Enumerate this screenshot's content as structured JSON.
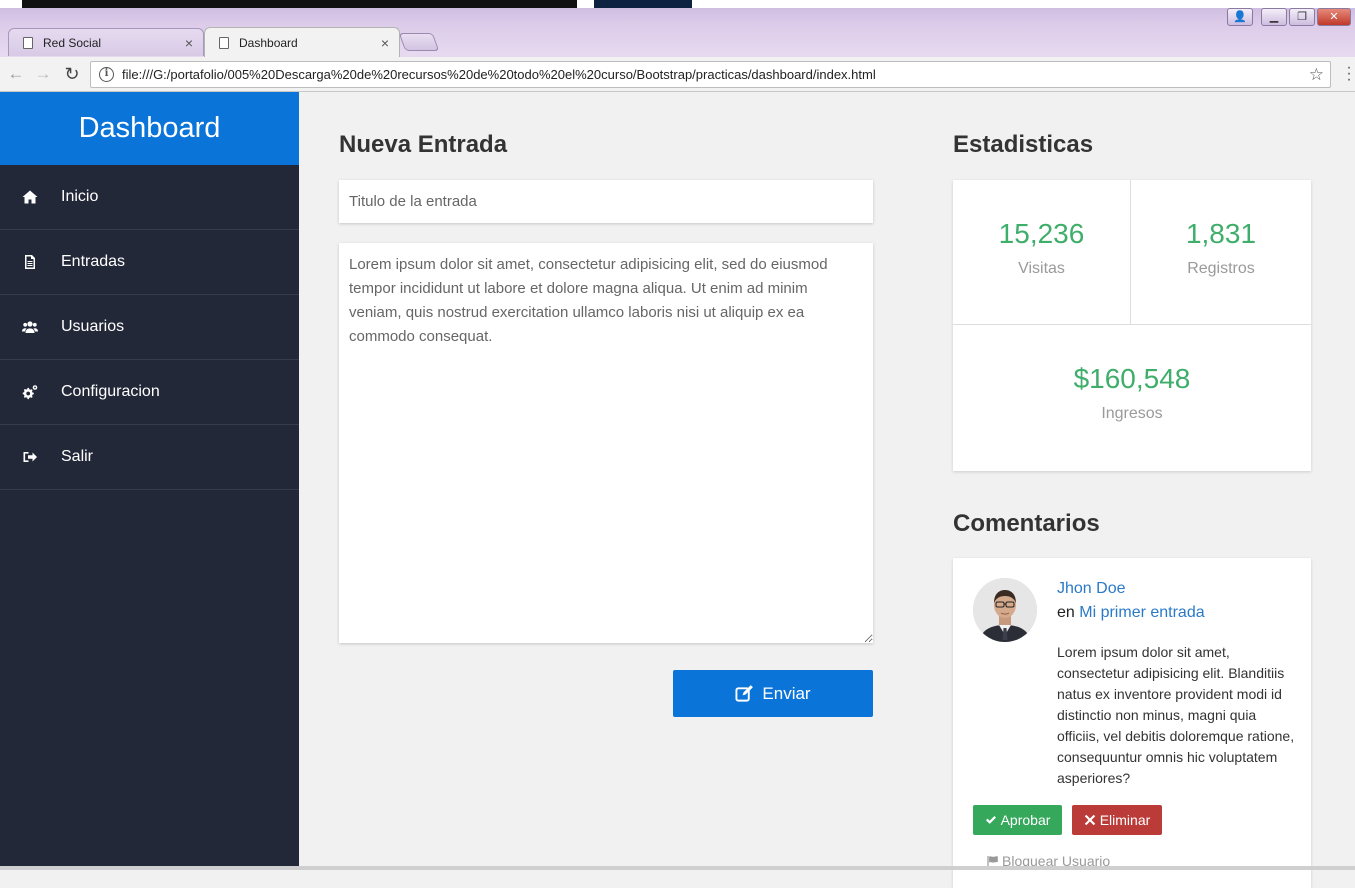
{
  "browser": {
    "tabs": [
      {
        "label": "Red Social",
        "close": "×"
      },
      {
        "label": "Dashboard",
        "close": "×"
      }
    ],
    "url": "file:///G:/portafolio/005%20Descarga%20de%20recursos%20de%20todo%20el%20curso/Bootstrap/practicas/dashboard/index.html",
    "info_icon": "i",
    "back_icon": "←",
    "forward_icon": "→",
    "reload_icon": "↻",
    "star_icon": "☆",
    "window_buttons": {
      "minimize": "▁",
      "restore": "❐",
      "close": "✕",
      "user": "👤"
    }
  },
  "sidebar": {
    "brand": "Dashboard",
    "items": [
      {
        "label": "Inicio",
        "icon": "home-icon"
      },
      {
        "label": "Entradas",
        "icon": "file-icon"
      },
      {
        "label": "Usuarios",
        "icon": "users-icon"
      },
      {
        "label": "Configuracion",
        "icon": "cogs-icon"
      },
      {
        "label": "Salir",
        "icon": "sign-out-icon"
      }
    ]
  },
  "new_post": {
    "title": "Nueva Entrada",
    "title_placeholder": "Titulo de la entrada",
    "body": "Lorem ipsum dolor sit amet, consectetur adipisicing elit, sed do eiusmod tempor incididunt ut labore et dolore magna aliqua. Ut enim ad minim veniam, quis nostrud exercitation ullamco laboris nisi ut aliquip ex ea commodo consequat.",
    "submit_label": "Enviar"
  },
  "stats": {
    "title": "Estadisticas",
    "visits": {
      "value": "15,236",
      "label": "Visitas"
    },
    "registers": {
      "value": "1,831",
      "label": "Registros"
    },
    "income": {
      "value": "$160,548",
      "label": "Ingresos"
    }
  },
  "comments": {
    "title": "Comentarios",
    "items": [
      {
        "author": "Jhon Doe",
        "prefix": "en",
        "post": "Mi primer entrada",
        "text": "Lorem ipsum dolor sit amet, consectetur adipisicing elit. Blanditiis natus ex inventore provident modi id distinctio non minus, magni quia officiis, vel debitis doloremque ratione, consequuntur omnis hic voluptatem asperiores?",
        "approve_label": "Aprobar",
        "delete_label": "Eliminar",
        "block_label": "Bloquear Usuario"
      }
    ]
  },
  "colors": {
    "brand_blue": "#0a74d9",
    "sidebar_bg": "#232838",
    "stat_green": "#3fae6a",
    "approve_green": "#35a85c",
    "delete_red": "#bb3b39",
    "link_blue": "#2a7ac7"
  }
}
